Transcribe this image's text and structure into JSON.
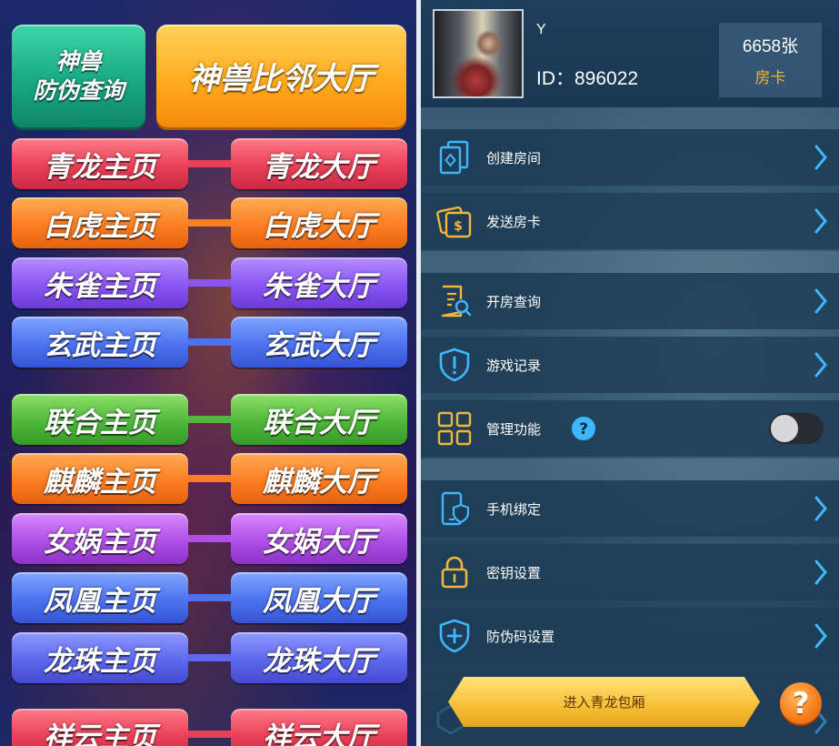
{
  "left": {
    "anti_counterfeit_label": "神兽\n防伪查询",
    "main_hall_label": "神兽比邻大厅",
    "pairs": [
      {
        "home": "青龙主页",
        "hall": "青龙大厅",
        "color": "#e94058"
      },
      {
        "home": "白虎主页",
        "hall": "白虎大厅",
        "color": "#fb7e22"
      },
      {
        "home": "朱雀主页",
        "hall": "朱雀大厅",
        "color": "#8a55f2"
      },
      {
        "home": "玄武主页",
        "hall": "玄武大厅",
        "color": "#4d72ef"
      },
      {
        "home": "联合主页",
        "hall": "联合大厅",
        "color": "#4fb83b"
      },
      {
        "home": "麒麟主页",
        "hall": "麒麟大厅",
        "color": "#fb7e22"
      },
      {
        "home": "女娲主页",
        "hall": "女娲大厅",
        "color": "#b04fe6"
      },
      {
        "home": "凤凰主页",
        "hall": "凤凰大厅",
        "color": "#4d72ef"
      },
      {
        "home": "龙珠主页",
        "hall": "龙珠大厅",
        "color": "#5e68ee"
      },
      {
        "home": "祥云主页",
        "hall": "祥云大厅",
        "color": "#e94058"
      }
    ]
  },
  "profile": {
    "name": "Y",
    "id_text": "ID：896022",
    "cards_count": "6658张",
    "cards_label": "房卡"
  },
  "menu": {
    "create_room": "创建房间",
    "send_cards": "发送房卡",
    "room_query": "开房查询",
    "game_records": "游戏记录",
    "management": "管理功能",
    "phone_binding": "手机绑定",
    "key_settings": "密钥设置",
    "anti_code_settings": "防伪码设置"
  },
  "management_toggle_on": false,
  "enter_button": "进入青龙包厢",
  "help_glyph": "?",
  "colors": {
    "accent_gold": "#f4b23a",
    "icon_blue": "#3fb7ff",
    "icon_gold": "#f2b63a"
  }
}
